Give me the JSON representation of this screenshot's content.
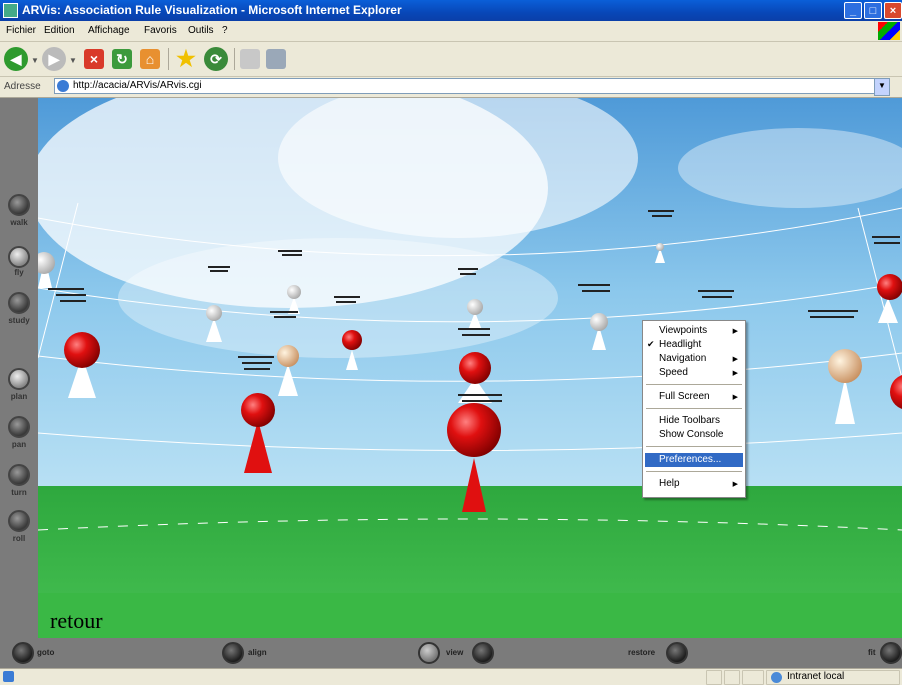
{
  "window": {
    "title": "ARVis: Association Rule Visualization - Microsoft Internet Explorer",
    "minimize_icon": "minimize-icon",
    "maximize_icon": "maximize-icon",
    "close_icon": "close-icon"
  },
  "menubar": {
    "items": [
      "Fichier",
      "Edition",
      "Affichage",
      "Favoris",
      "Outils",
      "?"
    ]
  },
  "toolbar": {
    "icons": [
      "back-icon",
      "forward-icon",
      "stop-icon",
      "refresh-icon",
      "home-icon",
      "favorites-icon",
      "history-icon",
      "mail-icon",
      "print-icon"
    ]
  },
  "address": {
    "label": "Adresse",
    "url": "http://acacia/ARVis/ARvis.cgi"
  },
  "scene": {
    "back_link": "retour"
  },
  "left_nav": {
    "items": [
      "walk",
      "fly",
      "study",
      "plan",
      "pan",
      "turn",
      "roll"
    ]
  },
  "bottom_nav": {
    "goto": "goto",
    "align": "align",
    "view": "view",
    "restore": "restore",
    "fit": "fit"
  },
  "context_menu": {
    "viewpoints": "Viewpoints",
    "headlight": "Headlight",
    "navigation": "Navigation",
    "speed": "Speed",
    "full_screen": "Full Screen",
    "hide_toolbars": "Hide Toolbars",
    "show_console": "Show Console",
    "preferences": "Preferences...",
    "help": "Help",
    "check_glyph": "✔",
    "arrow_glyph": "▶"
  },
  "status": {
    "zone": "Intranet local"
  },
  "colors": {
    "sphere_red": "#e01010",
    "sphere_white": "#ffffff",
    "sphere_tan": "#f0d0a0",
    "grass": "#3cb84a",
    "sky": "#5ea8e0",
    "menu_highlight": "#316ac5"
  }
}
